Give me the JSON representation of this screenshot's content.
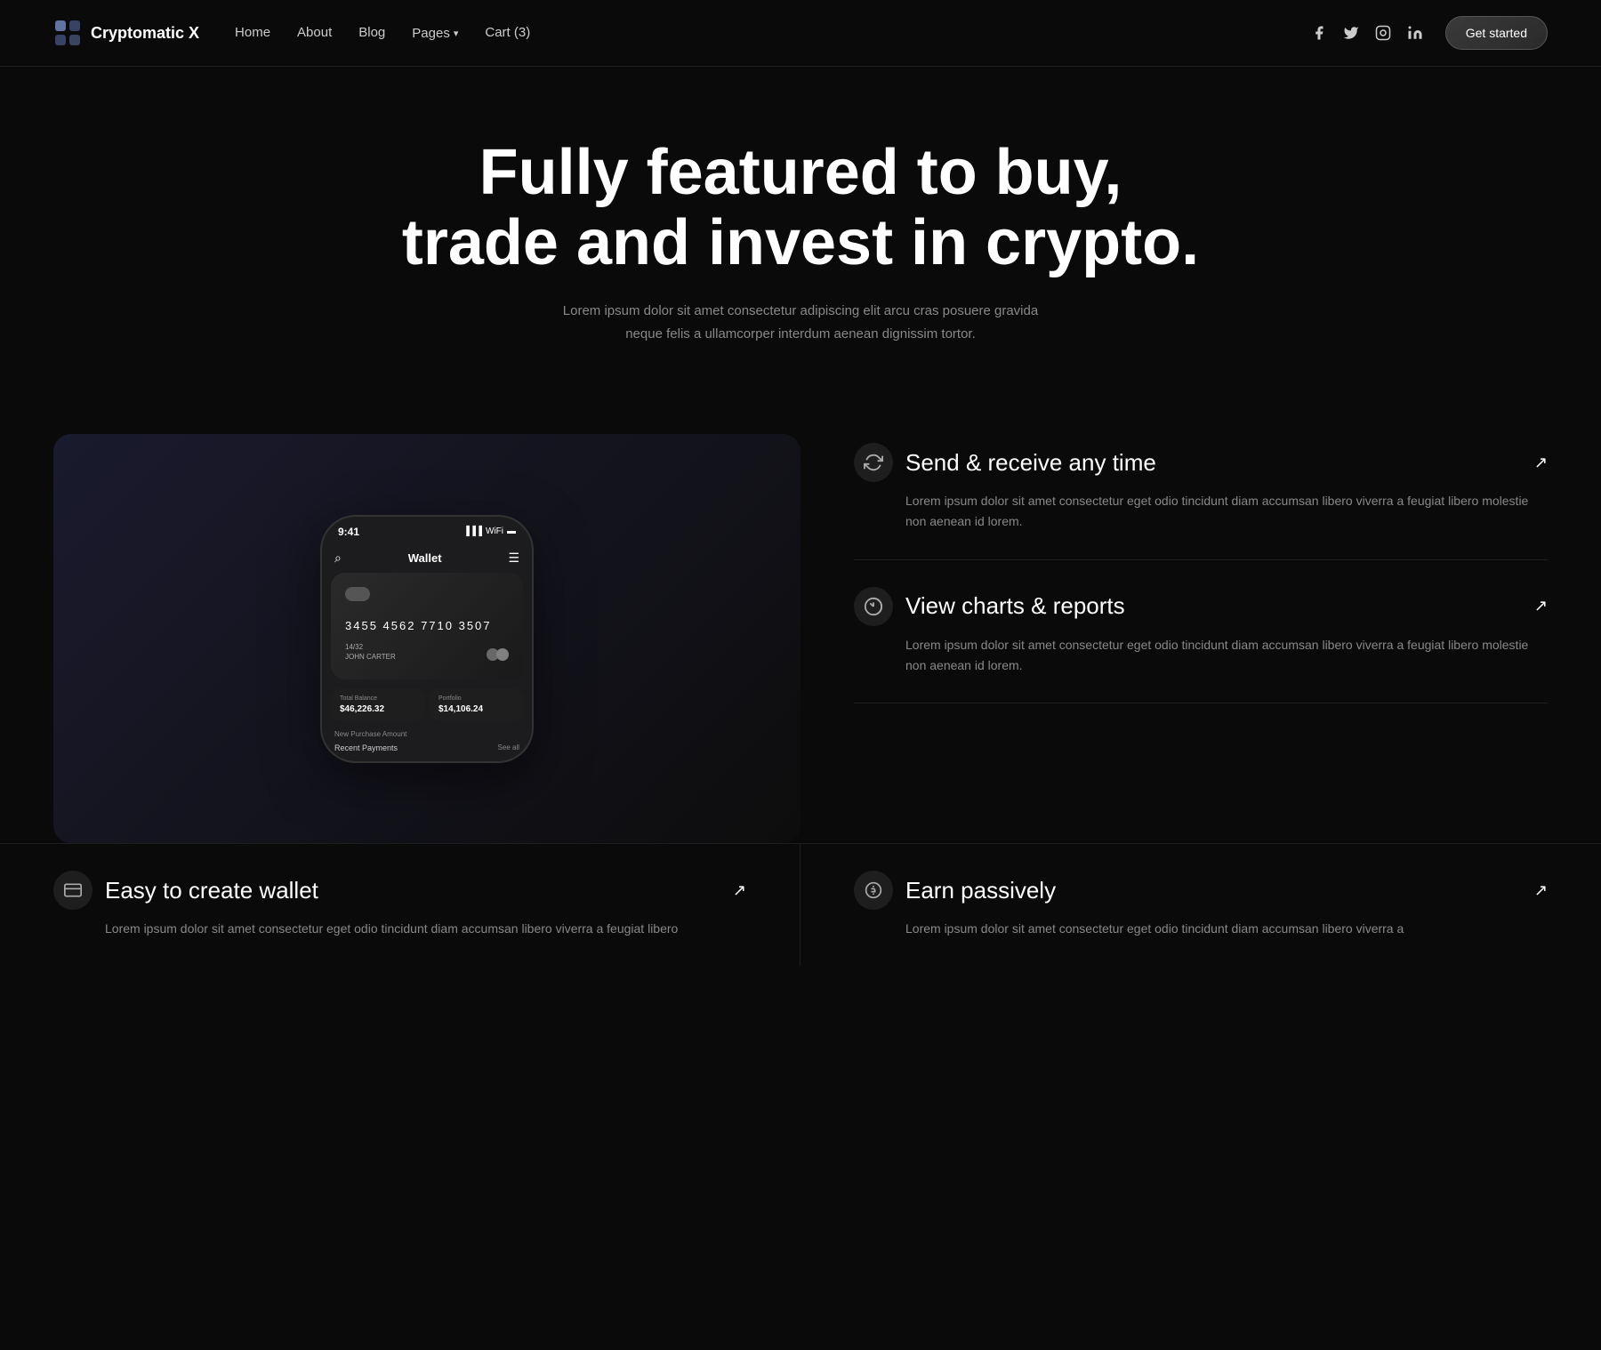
{
  "brand": {
    "name": "Cryptomatic X"
  },
  "nav": {
    "links": [
      {
        "label": "Home",
        "id": "home"
      },
      {
        "label": "About",
        "id": "about"
      },
      {
        "label": "Blog",
        "id": "blog"
      },
      {
        "label": "Pages",
        "id": "pages",
        "hasDropdown": true
      },
      {
        "label": "Cart (3)",
        "id": "cart"
      }
    ],
    "cta": "Get started"
  },
  "social": {
    "facebook": "f",
    "twitter": "t",
    "instagram": "i",
    "linkedin": "in"
  },
  "hero": {
    "title": "Fully featured to buy, trade and invest in crypto.",
    "subtitle": "Lorem ipsum dolor sit amet consectetur adipiscing elit arcu cras posuere gravida neque felis a ullamcorper interdum aenean dignissim tortor."
  },
  "phone": {
    "time": "9:41",
    "header_title": "Wallet",
    "card_number": "3455  4562  7710  3507",
    "card_expiry": "14/32",
    "card_owner": "JOHN CARTER",
    "total_balance_label": "Total Balance",
    "total_balance_value": "$46,226.32",
    "portfolio_label": "Portfolio",
    "portfolio_value": "$14,106.24",
    "new_purchase": "New Purchase Amount",
    "recent_payments": "Recent Payments",
    "see_all": "See all"
  },
  "features": [
    {
      "id": "send-receive",
      "icon": "🔄",
      "title": "Send & receive any time",
      "desc": "Lorem ipsum dolor sit amet consectetur eget odio tincidunt diam accumsan libero viverra a feugiat libero molestie non aenean id lorem."
    },
    {
      "id": "charts-reports",
      "icon": "📊",
      "title": "View charts & reports",
      "desc": "Lorem ipsum dolor sit amet consectetur eget odio tincidunt diam accumsan libero viverra a feugiat libero molestie non aenean id lorem."
    }
  ],
  "bottom_features": [
    {
      "id": "create-wallet",
      "icon": "💳",
      "title": "Easy to create wallet",
      "desc": "Lorem ipsum dolor sit amet consectetur eget odio tincidunt diam accumsan libero viverra a feugiat libero"
    },
    {
      "id": "earn-passively",
      "icon": "₿",
      "title": "Earn passively",
      "desc": "Lorem ipsum dolor sit amet consectetur eget odio tincidunt diam accumsan libero viverra a"
    }
  ]
}
